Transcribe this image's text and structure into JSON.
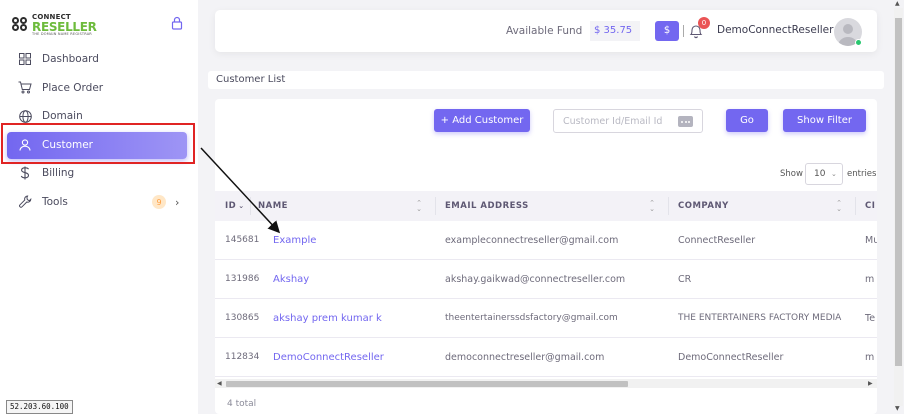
{
  "brand": {
    "top": "CONNECT",
    "main": "RESELLER",
    "sub": "THE DOMAIN NAME REGISTRAR"
  },
  "sidebar": {
    "items": [
      {
        "label": "Dashboard",
        "icon": "grid-icon"
      },
      {
        "label": "Place Order",
        "icon": "cart-icon"
      },
      {
        "label": "Domain",
        "icon": "globe-icon"
      },
      {
        "label": "Customer",
        "icon": "user-icon",
        "active": true
      },
      {
        "label": "Billing",
        "icon": "dollar-icon"
      },
      {
        "label": "Tools",
        "icon": "wrench-icon",
        "badge": "9"
      }
    ]
  },
  "header": {
    "fund_label": "Available Fund",
    "fund_value": "$ 35.75",
    "fund_button": "$",
    "notification_count": "0",
    "username": "DemoConnectReseller"
  },
  "breadcrumb": "Customer List",
  "toolbar": {
    "add_label": "+ Add Customer",
    "search_placeholder": "Customer Id/Email Id",
    "search_value": "",
    "go_label": "Go",
    "filter_label": "Show Filter"
  },
  "pagination": {
    "show_label": "Show",
    "page_size": "10",
    "entries_label": "entries"
  },
  "table": {
    "columns": [
      "ID",
      "NAME",
      "EMAIL ADDRESS",
      "COMPANY",
      "CI"
    ],
    "rows": [
      {
        "id": "145681",
        "name": "Example",
        "email": "exampleconnectreseller@gmail.com",
        "company": "ConnectReseller",
        "city": "Mu"
      },
      {
        "id": "131986",
        "name": "Akshay",
        "email": "akshay.gaikwad@connectreseller.com",
        "company": "CR",
        "city": "m"
      },
      {
        "id": "130865",
        "name": "akshay prem kumar k",
        "email": "theentertainerssdsfactory@gmail.com",
        "company": "THE ENTERTAINERS FACTORY MEDIA",
        "city": "Te"
      },
      {
        "id": "112834",
        "name": "DemoConnectReseller",
        "email": "democonnectreseller@gmail.com",
        "company": "DemoConnectReseller",
        "city": "m"
      }
    ]
  },
  "footer": {
    "total": "4 total"
  },
  "status_tip": "52.203.60.100",
  "colors": {
    "accent": "#7367f0",
    "highlight": "#e02424",
    "brand_green": "#6dbb3c"
  }
}
